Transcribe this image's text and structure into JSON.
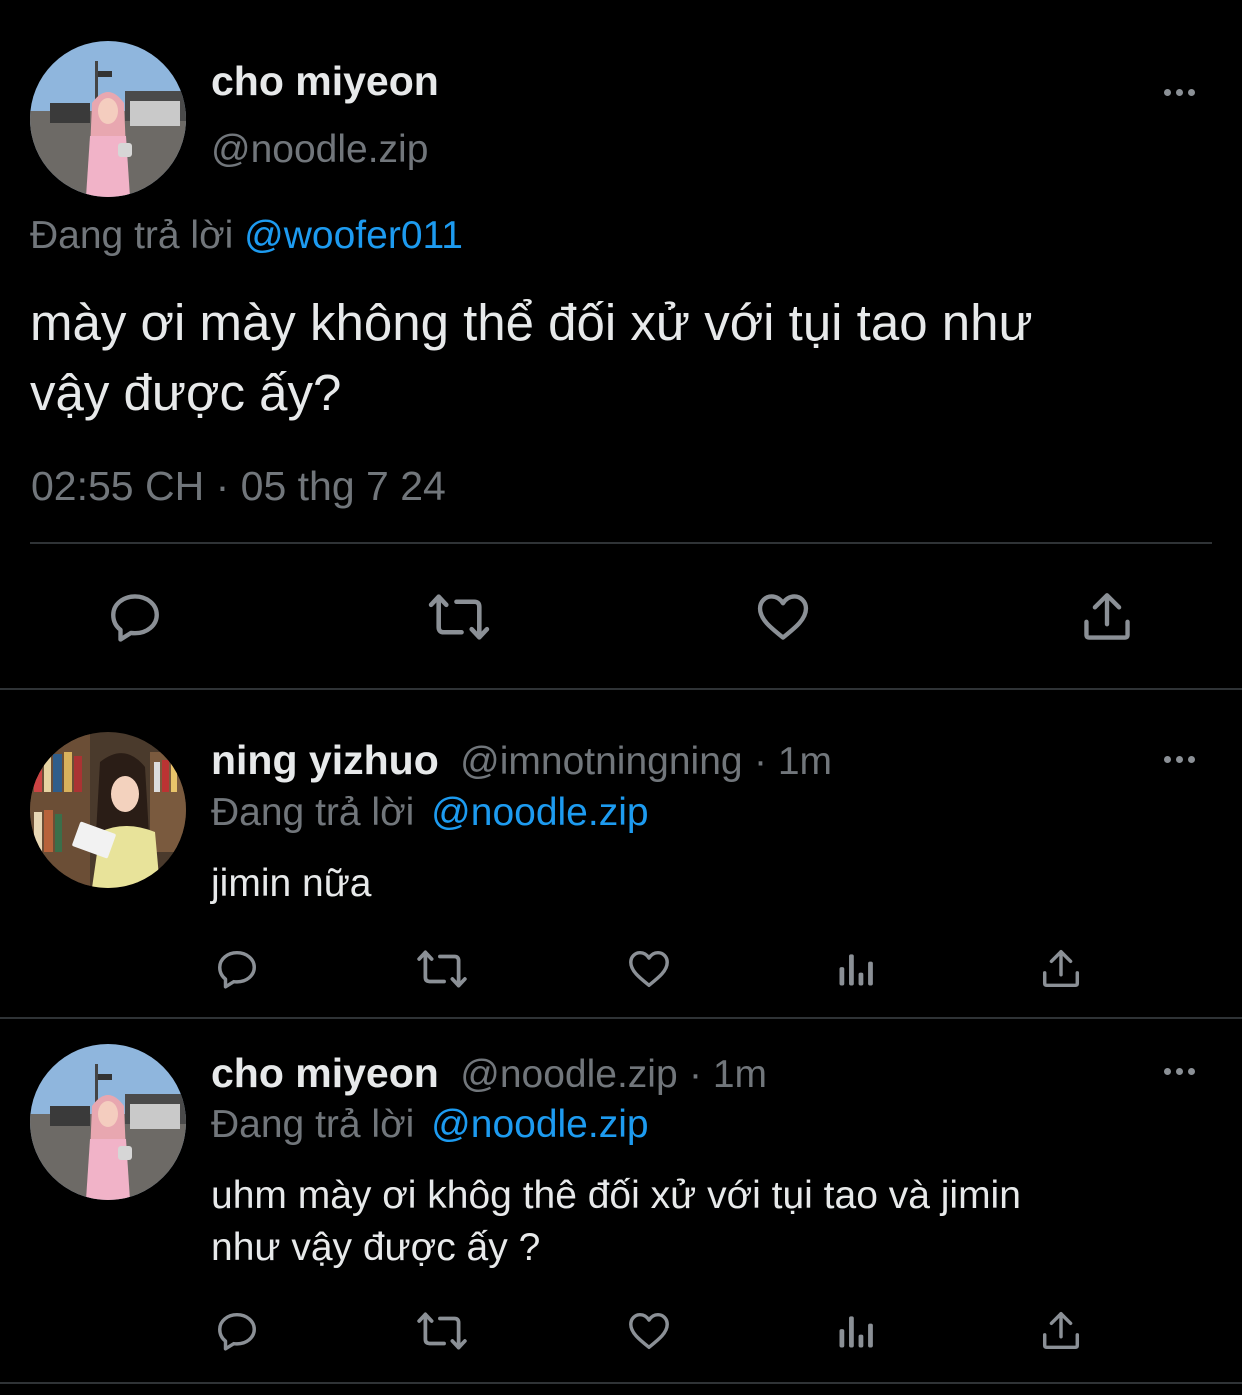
{
  "main_tweet": {
    "display_name": "cho miyeon",
    "handle": "@noodle.zip",
    "replying_prefix": "Đang trả lời",
    "replying_to": "@woofer011",
    "text_line1": "mày ơi mày không thể đối xử với tụi tao như",
    "text_line2": "vậy được ấy?",
    "timestamp": "02:55 CH · 05 thg 7 24"
  },
  "replies": [
    {
      "display_name": "ning yizhuo",
      "handle": "@imnotningning",
      "time": "· 1m",
      "replying_prefix": "Đang trả lời",
      "replying_to": "@noodle.zip",
      "text_line1": "jimin nữa",
      "text_line2": ""
    },
    {
      "display_name": "cho miyeon",
      "handle": "@noodle.zip",
      "time": "· 1m",
      "replying_prefix": "Đang trả lời",
      "replying_to": "@noodle.zip",
      "text_line1": "uhm mày ơi khôg thê đối xử với tụi tao và jimin",
      "text_line2": "như vậy được ấy ?"
    }
  ],
  "colors": {
    "background": "#000000",
    "text": "#e7e9ea",
    "muted": "#71767b",
    "link": "#1d9bf0",
    "divider": "#2f3336"
  },
  "icons": [
    "reply-icon",
    "retweet-icon",
    "like-icon",
    "views-icon",
    "share-icon",
    "more-icon"
  ]
}
